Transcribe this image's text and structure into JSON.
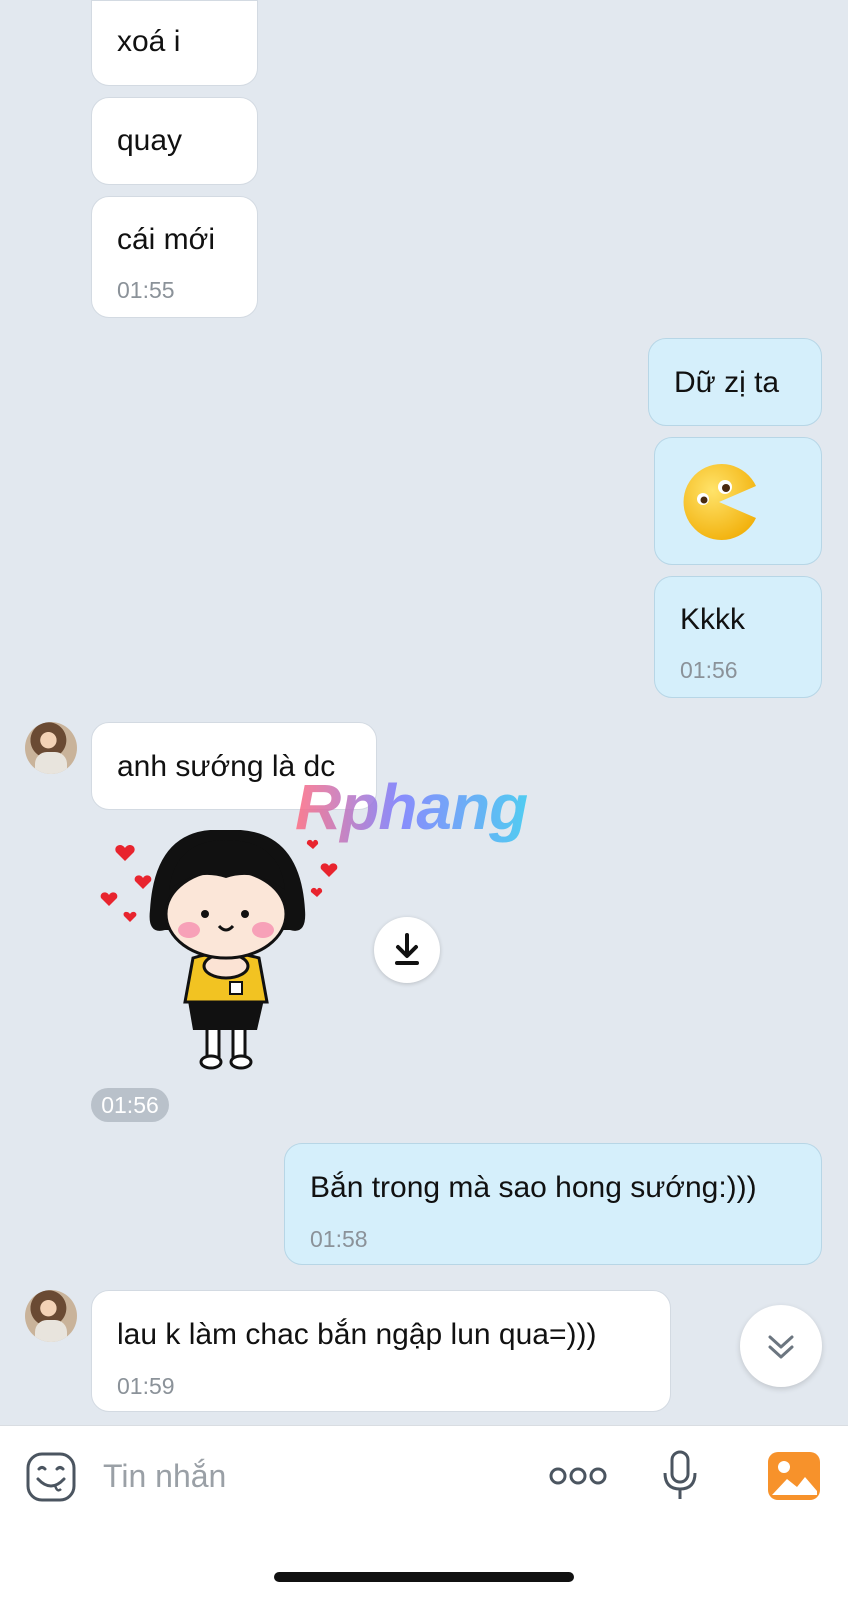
{
  "messages": [
    {
      "side": "in",
      "text": "xoá i",
      "time": ""
    },
    {
      "side": "in",
      "text": "quay",
      "time": ""
    },
    {
      "side": "in",
      "text": "cái mới",
      "time": "01:55"
    },
    {
      "side": "out",
      "text": "Dữ zị ta",
      "time": ""
    },
    {
      "side": "out",
      "text": "",
      "time": "",
      "emoji": "pacman-emoji"
    },
    {
      "side": "out",
      "text": "Kkkk",
      "time": "01:56"
    },
    {
      "side": "in",
      "text": "anh sướng là dc",
      "time": ""
    },
    {
      "side": "in",
      "sticker": "girl-hearts-sticker",
      "time": "01:56"
    },
    {
      "side": "out",
      "text": "Bắn trong mà sao hong sướng:)))",
      "time": "01:58"
    },
    {
      "side": "in",
      "text": "lau k làm chac bắn ngập lun qua=)))",
      "time": "01:59"
    }
  ],
  "watermark": "Rphang",
  "composer": {
    "placeholder": "Tin nhắn",
    "icons": [
      "emoji-icon",
      "more-icon",
      "microphone-icon",
      "image-icon"
    ]
  },
  "colors": {
    "background": "#e2e8ef",
    "incoming_bubble": "#ffffff",
    "outgoing_bubble": "#d5effb",
    "accent_image_icon": "#f7922b"
  }
}
